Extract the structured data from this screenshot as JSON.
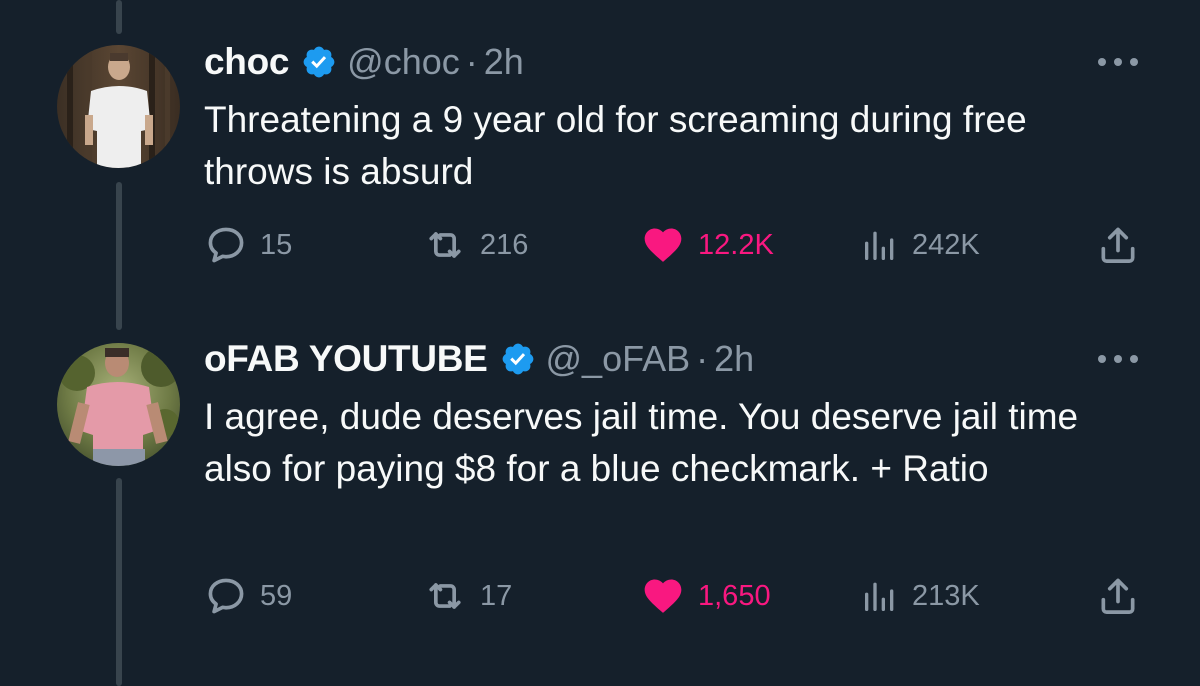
{
  "colors": {
    "background": "#15202b",
    "text_primary": "#f7f9f9",
    "text_secondary": "#8b98a5",
    "verified_blue": "#1d9bf0",
    "like_pink": "#f91880",
    "thread_line": "#38444d"
  },
  "tweets": [
    {
      "display_name": "choc",
      "handle": "@choc",
      "separator": "·",
      "time": "2h",
      "text": "Threatening a 9 year old for screaming during free throws is absurd",
      "verified": true,
      "actions": {
        "replies": "15",
        "retweets": "216",
        "likes": "12.2K",
        "views": "242K"
      },
      "liked": true
    },
    {
      "display_name": "oFAB YOUTUBE",
      "handle": "@_oFAB",
      "separator": "·",
      "time": "2h",
      "text": "I agree, dude deserves jail time. You deserve jail time also for paying $8 for a blue checkmark. + Ratio",
      "verified": true,
      "actions": {
        "replies": "59",
        "retweets": "17",
        "likes": "1,650",
        "views": "213K"
      },
      "liked": true
    }
  ],
  "icons": {
    "more": "more-horizontal-icon",
    "reply": "reply-bubble-icon",
    "retweet": "retweet-icon",
    "like": "heart-filled-icon",
    "views": "views-bar-chart-icon",
    "share": "share-upload-icon",
    "verified": "verified-badge-icon"
  }
}
